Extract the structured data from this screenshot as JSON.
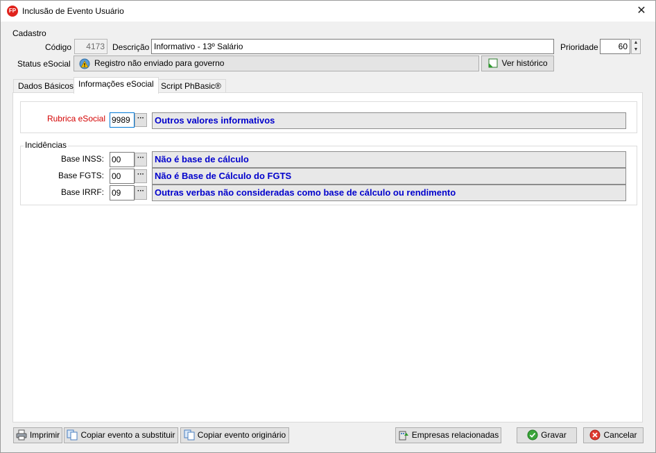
{
  "window": {
    "title": "Inclusão de Evento Usuário",
    "close": "✕",
    "app_icon_text": "FP"
  },
  "cadastro": {
    "group_title": "Cadastro",
    "codigo_label": "Código",
    "codigo_value": "4173",
    "descricao_label": "Descrição",
    "descricao_value": "Informativo - 13º Salário",
    "prioridade_label": "Prioridade",
    "prioridade_value": "60",
    "status_label": "Status eSocial",
    "status_value": "Registro não enviado para governo",
    "historico_button": "Ver histórico"
  },
  "tabs": [
    {
      "label": "Dados Básicos"
    },
    {
      "label": "Informações eSocial"
    },
    {
      "label": "Script PhBasic®"
    }
  ],
  "esocial": {
    "rubrica_label": "Rubrica eSocial",
    "rubrica_code": "9989",
    "rubrica_desc": "Outros valores informativos",
    "incidencias_title": "Incidências",
    "rows": [
      {
        "label": "Base INSS:",
        "code": "00",
        "desc": "Não é base de cálculo"
      },
      {
        "label": "Base FGTS:",
        "code": "00",
        "desc": "Não é Base de Cálculo do FGTS"
      },
      {
        "label": "Base IRRF:",
        "code": "09",
        "desc": "Outras verbas não consideradas como base de cálculo ou rendimento"
      }
    ],
    "dots": "···"
  },
  "footer": {
    "imprimir": "Imprimir",
    "copiar_substituir": "Copiar evento a substituir",
    "copiar_originario": "Copiar evento originário",
    "empresas": "Empresas relacionadas",
    "gravar": "Gravar",
    "cancelar": "Cancelar"
  },
  "colors": {
    "accent_blue": "#0000cc",
    "required_red": "#d40000",
    "brand_red": "#e0221c"
  }
}
